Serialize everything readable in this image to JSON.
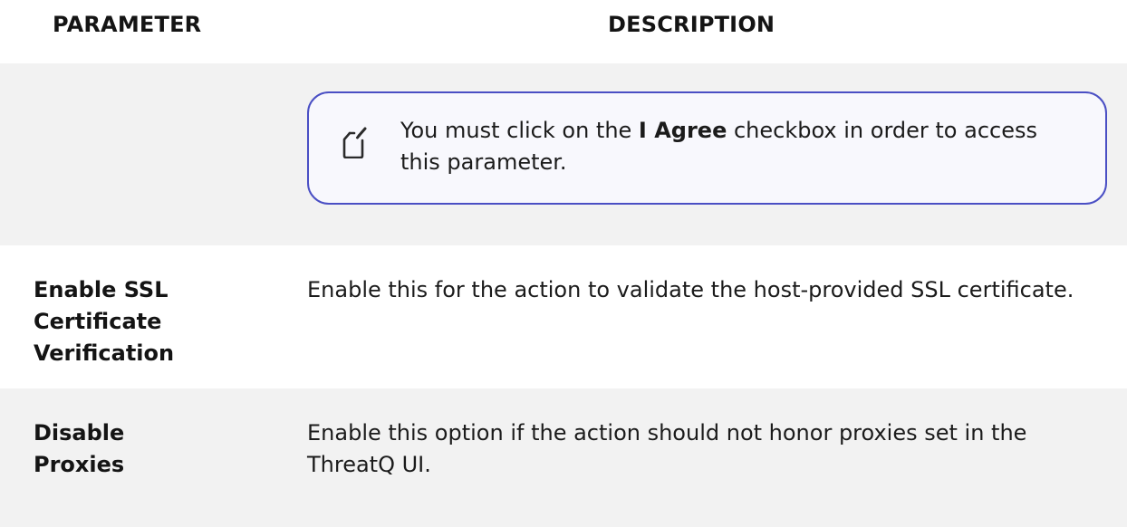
{
  "header": {
    "parameter": "PARAMETER",
    "description": "DESCRIPTION"
  },
  "note": {
    "icon": "note-pencil-icon",
    "text_before": "You must click on the ",
    "text_bold": "I Agree",
    "text_after": " checkbox in order to access this parameter.",
    "accent_color": "#4a4fc4"
  },
  "rows": [
    {
      "parameter": "Enable SSL Certificate Verification",
      "description": "Enable this for the action to validate the host-provided SSL certificate."
    },
    {
      "parameter": "Disable Proxies",
      "description": "Enable this option if the action should not honor proxies set in the ThreatQ UI."
    }
  ]
}
